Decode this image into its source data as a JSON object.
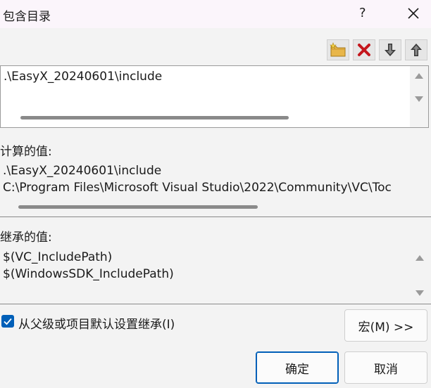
{
  "window": {
    "title": "包含目录",
    "help_label": "?",
    "close_label": "✕"
  },
  "toolbar": {
    "buttons": [
      {
        "name": "new-folder-button",
        "icon": "new-folder-icon"
      },
      {
        "name": "delete-button",
        "icon": "delete-icon"
      },
      {
        "name": "move-down-button",
        "icon": "arrow-down-icon"
      },
      {
        "name": "move-up-button",
        "icon": "arrow-up-icon"
      }
    ]
  },
  "editor": {
    "lines": [
      ".\\EasyX_20240601\\include"
    ]
  },
  "evaluated": {
    "label": "计算的值:",
    "lines": [
      ".\\EasyX_20240601\\include",
      "C:\\Program Files\\Microsoft Visual Studio\\2022\\Community\\VC\\Toc"
    ]
  },
  "inherited": {
    "label": "继承的值:",
    "lines": [
      "$(VC_IncludePath)",
      "$(WindowsSDK_IncludePath)"
    ]
  },
  "inherit_checkbox": {
    "label": "从父级或项目默认设置继承(I)",
    "checked": true
  },
  "buttons": {
    "macros": "宏(M) >>",
    "ok": "确定",
    "cancel": "取消"
  },
  "colors": {
    "accent": "#005fb8",
    "delete_red": "#c4161c"
  }
}
